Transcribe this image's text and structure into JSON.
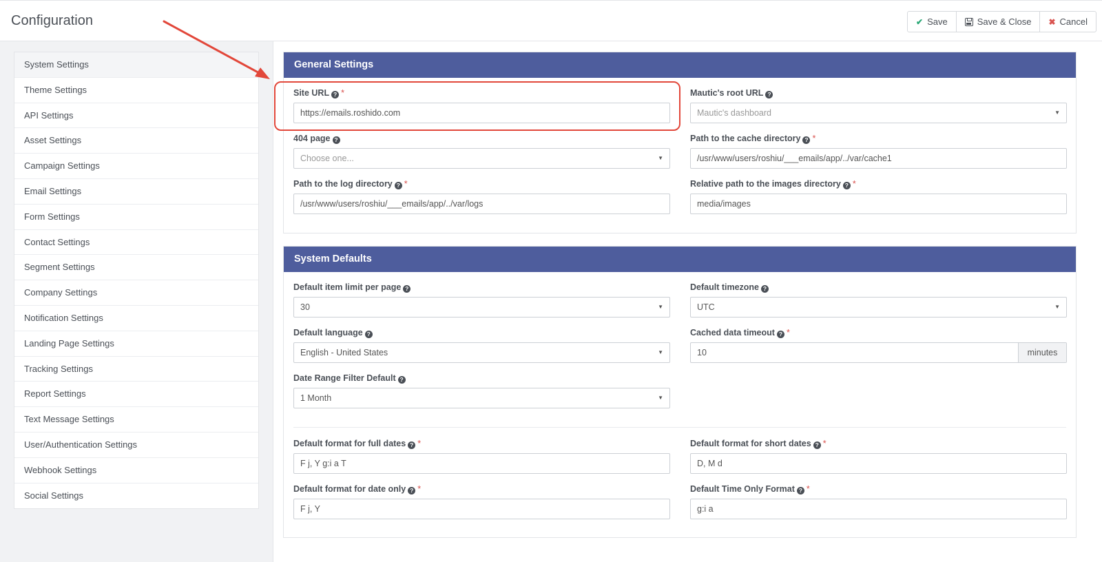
{
  "header": {
    "title": "Configuration"
  },
  "toolbar": {
    "save": "Save",
    "save_close": "Save & Close",
    "cancel": "Cancel"
  },
  "sidebar": {
    "items": [
      {
        "label": "System Settings"
      },
      {
        "label": "Theme Settings"
      },
      {
        "label": "API Settings"
      },
      {
        "label": "Asset Settings"
      },
      {
        "label": "Campaign Settings"
      },
      {
        "label": "Email Settings"
      },
      {
        "label": "Form Settings"
      },
      {
        "label": "Contact Settings"
      },
      {
        "label": "Segment Settings"
      },
      {
        "label": "Company Settings"
      },
      {
        "label": "Notification Settings"
      },
      {
        "label": "Landing Page Settings"
      },
      {
        "label": "Tracking Settings"
      },
      {
        "label": "Report Settings"
      },
      {
        "label": "Text Message Settings"
      },
      {
        "label": "User/Authentication Settings"
      },
      {
        "label": "Webhook Settings"
      },
      {
        "label": "Social Settings"
      }
    ]
  },
  "general": {
    "title": "General Settings",
    "site_url": {
      "label": "Site URL",
      "value": "https://emails.roshido.com"
    },
    "root_url": {
      "label": "Mautic's root URL",
      "placeholder": "Mautic's dashboard"
    },
    "page404": {
      "label": "404 page",
      "placeholder": "Choose one..."
    },
    "cache_dir": {
      "label": "Path to the cache directory",
      "value": "/usr/www/users/roshiu/___emails/app/../var/cache1"
    },
    "log_dir": {
      "label": "Path to the log directory",
      "value": "/usr/www/users/roshiu/___emails/app/../var/logs"
    },
    "images_dir": {
      "label": "Relative path to the images directory",
      "value": "media/images"
    }
  },
  "defaults": {
    "title": "System Defaults",
    "item_limit": {
      "label": "Default item limit per page",
      "value": "30"
    },
    "timezone": {
      "label": "Default timezone",
      "value": "UTC"
    },
    "language": {
      "label": "Default language",
      "value": "English - United States"
    },
    "cache_timeout": {
      "label": "Cached data timeout",
      "value": "10",
      "unit": "minutes"
    },
    "date_range": {
      "label": "Date Range Filter Default",
      "value": "1 Month"
    },
    "full_dates": {
      "label": "Default format for full dates",
      "value": "F j, Y g:i a T"
    },
    "short_dates": {
      "label": "Default format for short dates",
      "value": "D, M d"
    },
    "date_only": {
      "label": "Default format for date only",
      "value": "F j, Y"
    },
    "time_only": {
      "label": "Default Time Only Format",
      "value": "g:i a"
    }
  },
  "colors": {
    "panel_header": "#4e5d9d",
    "required": "#d9534f",
    "annotation": "#e2473a",
    "check": "#2aa876"
  }
}
